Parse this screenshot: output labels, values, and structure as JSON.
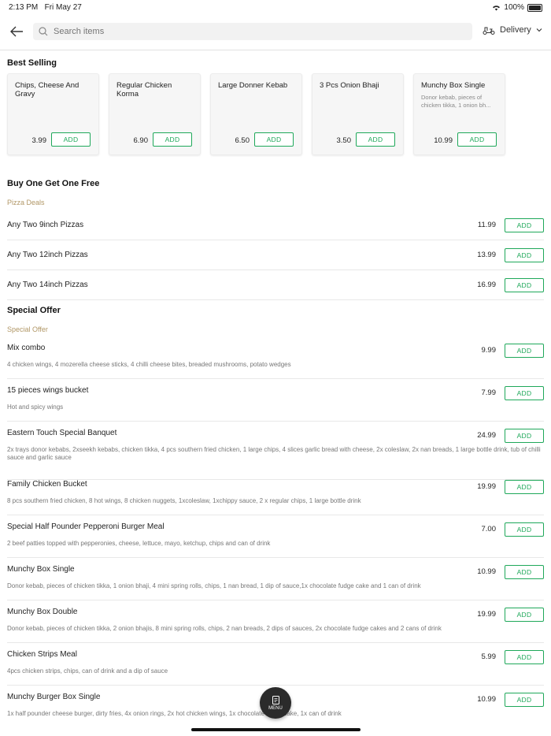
{
  "status": {
    "time": "2:13 PM",
    "date": "Fri May 27",
    "battery": "100%"
  },
  "search": {
    "placeholder": "Search items"
  },
  "delivery_label": "Delivery",
  "best_selling": {
    "title": "Best Selling",
    "items": [
      {
        "name": "Chips, Cheese And Gravy",
        "desc": "",
        "price": "3.99",
        "add": "ADD"
      },
      {
        "name": "Regular Chicken Korma",
        "desc": "",
        "price": "6.90",
        "add": "ADD"
      },
      {
        "name": "Large Donner Kebab",
        "desc": "",
        "price": "6.50",
        "add": "ADD"
      },
      {
        "name": "3 Pcs Onion Bhaji",
        "desc": "",
        "price": "3.50",
        "add": "ADD"
      },
      {
        "name": "Munchy Box Single",
        "desc": "Donor kebab, pieces of chicken tikka, 1 onion bh...",
        "price": "10.99",
        "add": "ADD"
      }
    ]
  },
  "bogof": {
    "title": "Buy One Get One Free",
    "subcategory": "Pizza Deals",
    "items": [
      {
        "name": "Any Two 9inch Pizzas",
        "price": "11.99",
        "add": "ADD"
      },
      {
        "name": "Any Two 12inch Pizzas",
        "price": "13.99",
        "add": "ADD"
      },
      {
        "name": "Any Two 14inch Pizzas",
        "price": "16.99",
        "add": "ADD"
      }
    ]
  },
  "special": {
    "title": "Special Offer",
    "subcategory": "Special Offer",
    "items": [
      {
        "name": "Mix combo",
        "desc": "4 chicken wings, 4 mozerella cheese sticks, 4 chilli cheese bites, breaded mushrooms, potato wedges",
        "price": "9.99",
        "add": "ADD"
      },
      {
        "name": "15 pieces wings bucket",
        "desc": "Hot and spicy wings",
        "price": "7.99",
        "add": "ADD"
      },
      {
        "name": "Eastern Touch Special Banquet",
        "desc": "2x trays donor kebabs, 2xseekh kebabs, chicken tikka, 4 pcs southern fried chicken, 1 large chips, 4 slices garlic bread with cheese,  2x coleslaw, 2x nan breads, 1 large bottle drink, tub of chilli sauce and garlic sauce",
        "price": "24.99",
        "add": "ADD"
      },
      {
        "name": "Family Chicken Bucket",
        "desc": "8 pcs southern fried chicken, 8 hot wings, 8 chicken nuggets, 1xcoleslaw, 1xchippy sauce, 2 x regular chips, 1 large bottle drink",
        "price": "19.99",
        "add": "ADD"
      },
      {
        "name": "Special Half Pounder Pepperoni Burger Meal",
        "desc": "2 beef patties topped with pepperonies, cheese, lettuce, mayo, ketchup, chips and can of drink",
        "price": "7.00",
        "add": "ADD"
      },
      {
        "name": "Munchy Box Single",
        "desc": "Donor kebab, pieces of chicken tikka, 1 onion bhaji, 4 mini spring rolls, chips, 1 nan bread, 1 dip of sauce,1x chocolate fudge cake and 1 can of drink",
        "price": "10.99",
        "add": "ADD"
      },
      {
        "name": "Munchy Box Double",
        "desc": "Donor kebab, pieces of chicken tikka, 2 onion bhajis, 8 mini spring rolls, chips, 2 nan breads, 2 dips of sauces, 2x chocolate fudge cakes and 2 cans of drink",
        "price": "19.99",
        "add": "ADD"
      },
      {
        "name": "Chicken Strips Meal",
        "desc": "4pcs chicken strips, chips, can of drink and a dip of sauce",
        "price": "5.99",
        "add": "ADD"
      },
      {
        "name": "Munchy Burger Box Single",
        "desc": "1x half pounder cheese burger, dirty fries, 4x onion rings, 2x hot chicken wings, 1x chocolate fudge cake, 1x can of drink",
        "price": "10.99",
        "add": "ADD"
      }
    ]
  },
  "menu_label": "MENU",
  "accent_color": "#1fa85a"
}
